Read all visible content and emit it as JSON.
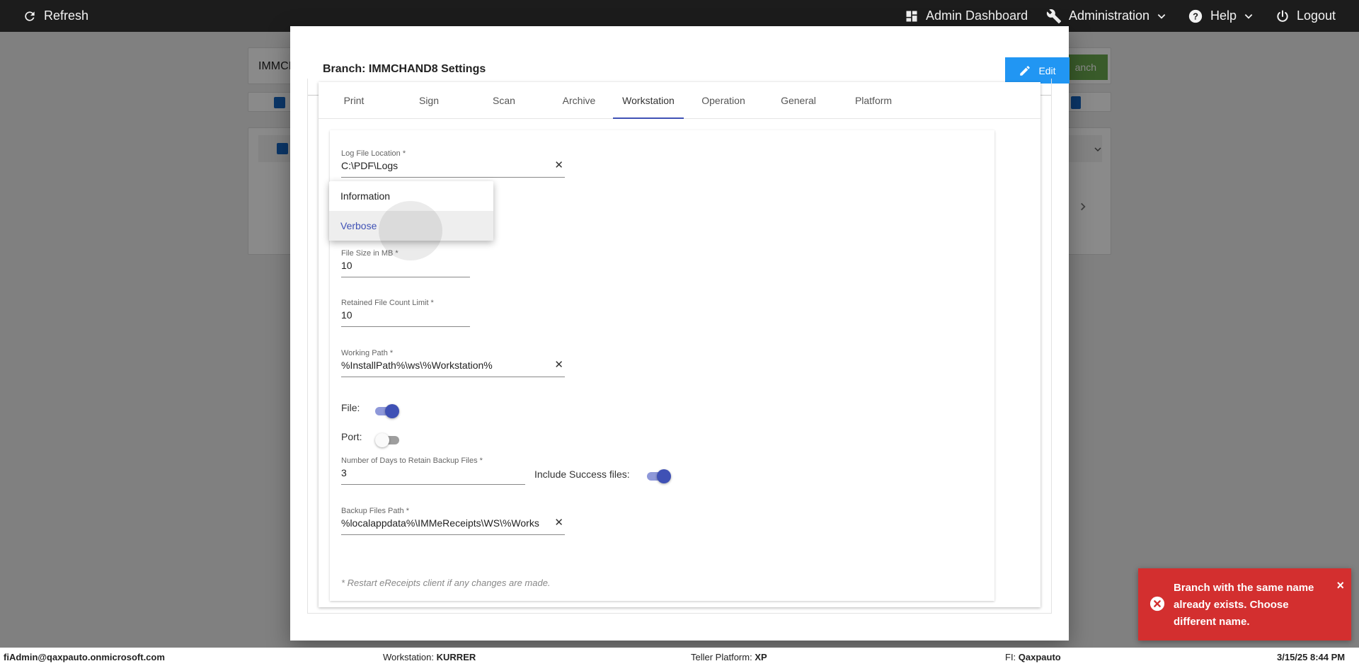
{
  "topbar": {
    "refresh_label": "Refresh",
    "admin_dashboard_label": "Admin Dashboard",
    "administration_label": "Administration",
    "help_label": "Help",
    "logout_label": "Logout"
  },
  "background": {
    "search_value": "IMMCI",
    "add_button_partial": "anch"
  },
  "modal": {
    "title": "Branch: IMMCHAND8 Settings",
    "edit_label": "Edit",
    "tabs": [
      {
        "label": "Print"
      },
      {
        "label": "Sign"
      },
      {
        "label": "Scan"
      },
      {
        "label": "Archive"
      },
      {
        "label": "Workstation"
      },
      {
        "label": "Operation"
      },
      {
        "label": "General"
      },
      {
        "label": "Platform"
      }
    ],
    "active_tab": "Workstation",
    "fields": {
      "log_file_location": {
        "label": "Log File Location *",
        "value": "C:\\PDF\\Logs"
      },
      "file_size": {
        "label": "File Size in MB *",
        "value": "10"
      },
      "retained_count": {
        "label": "Retained File Count Limit *",
        "value": "10"
      },
      "working_path": {
        "label": "Working Path *",
        "value": "%InstallPath%\\ws\\%Workstation%"
      },
      "days_retain": {
        "label": "Number of Days to Retain Backup Files *",
        "value": "3"
      },
      "backup_path": {
        "label": "Backup Files Path *",
        "value": "%localappdata%\\IMMeReceipts\\WS\\%Works"
      }
    },
    "toggles": {
      "file": {
        "label": "File:",
        "on": true
      },
      "port": {
        "label": "Port:",
        "on": false
      },
      "include_success": {
        "label": "Include Success files:",
        "on": true
      }
    },
    "log_level_menu": {
      "options": [
        "Information",
        "Verbose"
      ],
      "selected": "Verbose",
      "ghost_text": "Verbose"
    },
    "note": "* Restart eReceipts client if any changes are made."
  },
  "footer": {
    "user": "fiAdmin@qaxpauto.onmicrosoft.com",
    "workstation_label": "Workstation:",
    "workstation_value": "KURRER",
    "teller_label": "Teller Platform:",
    "teller_value": "XP",
    "fi_label": "FI:",
    "fi_value": "Qaxpauto",
    "datetime": "3/15/25 8:44 PM"
  },
  "toast": {
    "message": "Branch with the same name already exists. Choose different name.",
    "close_label": "×"
  },
  "colors": {
    "primary": "#3f51b5",
    "edit_button": "#2196f3",
    "toast_error": "#d32f2f",
    "add_button": "#6aa84f"
  }
}
